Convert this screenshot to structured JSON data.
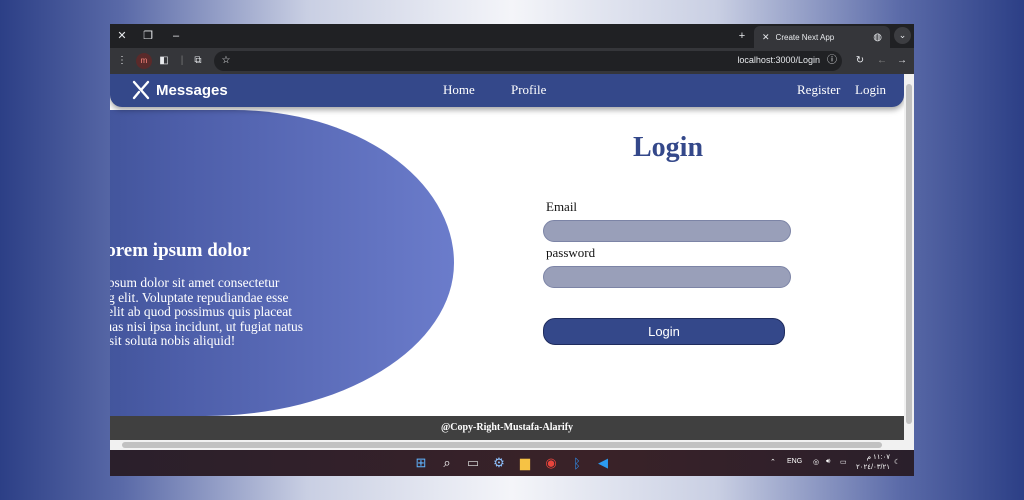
{
  "browser": {
    "tab_title": "Create Next App",
    "url": "localhost:3000/Login"
  },
  "navbar": {
    "brand": "Messages",
    "links": [
      "Home",
      "Profile",
      "Register",
      "Login"
    ]
  },
  "hero": {
    "title": "Lorem ipsum dolor",
    "text": "Lorem ipsum dolor sit amet consectetur adipisicing elit. Voluptate repudiandae esse dolorem velit ab quod possimus quis placeat molestias, quas nisi ipsa incidunt, ut fugiat natus sit soluta nobis aliquid!"
  },
  "login": {
    "title": "Login",
    "email_label": "Email",
    "email_value": "",
    "password_label": "password",
    "password_value": "",
    "button": "Login"
  },
  "footer": {
    "text": "@Copy-Right-Mustafa-Alarify"
  },
  "taskbar": {
    "lang": "ENG",
    "time": "١١:٠٧ م",
    "date": "٢٠٢٤/٠٣/٢١"
  },
  "colors": {
    "primary": "#34488a",
    "field": "#999fb9",
    "footer": "#404040"
  }
}
